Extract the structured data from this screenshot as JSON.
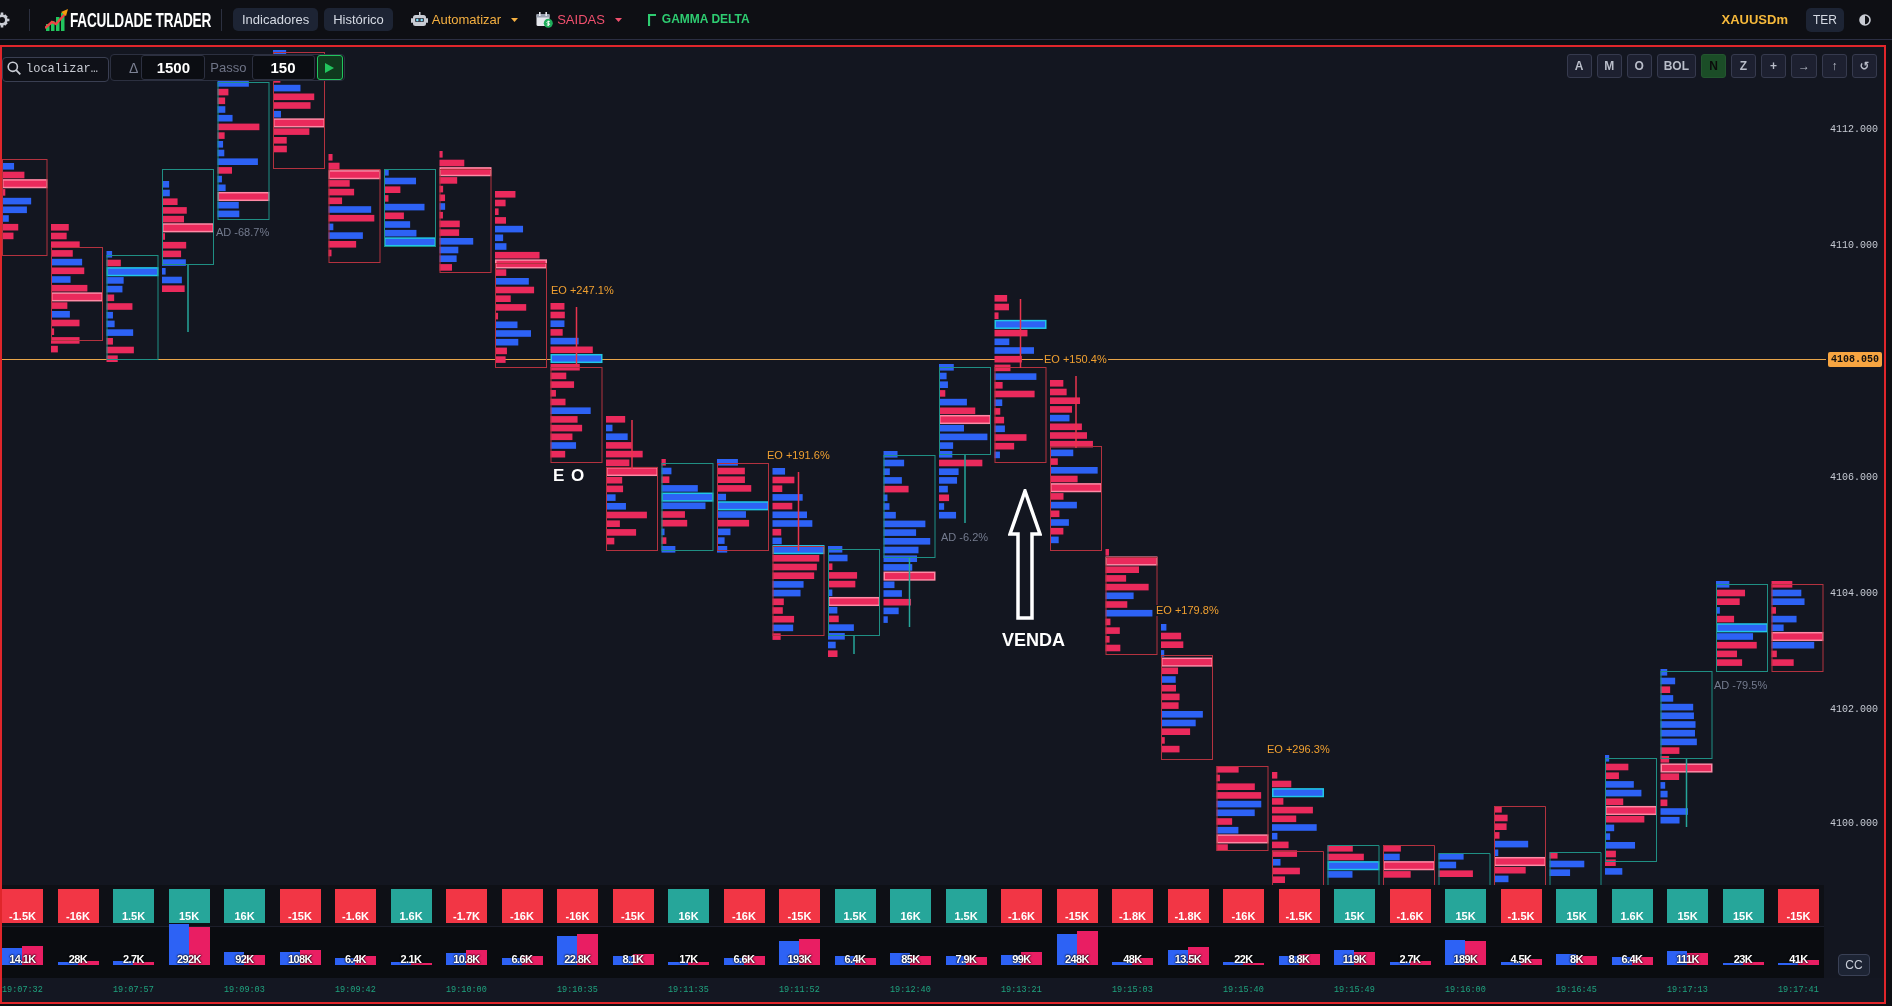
{
  "header": {
    "brand": "FACULDADE TRADER",
    "menu": [
      {
        "label": "Indicadores",
        "kind": "pill"
      },
      {
        "label": "Histórico",
        "kind": "pill"
      },
      {
        "label": "Automatizar",
        "kind": "dropdown",
        "color": "#f5b041"
      },
      {
        "label": "SAIDAS",
        "kind": "dropdown",
        "color": "#f0506e"
      },
      {
        "label": "GAMMA DELTA",
        "kind": "link",
        "color": "#2ecc71"
      }
    ],
    "symbol": "XAUUSDm",
    "timeframe": "TER"
  },
  "toolbar": {
    "search": {
      "placeholder": "localizar…"
    },
    "delta_label": "Δ",
    "size": {
      "value": "1500"
    },
    "step": {
      "label": "Passo",
      "value": "150"
    }
  },
  "chart_buttons": [
    {
      "label": "A",
      "selected": false
    },
    {
      "label": "M",
      "selected": false
    },
    {
      "label": "O",
      "selected": false
    },
    {
      "label": "BOL",
      "selected": false
    },
    {
      "label": "N",
      "selected": true
    },
    {
      "label": "Z",
      "selected": false
    },
    {
      "label": "+",
      "selected": false
    },
    {
      "label": "→",
      "selected": false
    },
    {
      "label": "↑",
      "selected": false
    },
    {
      "label": "↺",
      "selected": false
    }
  ],
  "chart": {
    "price_labels": [
      "4112.000",
      "4110.000",
      "4106.000",
      "4104.000",
      "4102.000",
      "4100.000"
    ],
    "last_price": "4108.050",
    "annotations": [
      {
        "text": "AD -68.7%",
        "kind": "ad"
      },
      {
        "text": "EO +247.1%",
        "kind": "eo"
      },
      {
        "text": "E O",
        "kind": "mark"
      },
      {
        "text": "EO +191.6%",
        "kind": "eo"
      },
      {
        "text": "AD -6.2%",
        "kind": "ad"
      },
      {
        "text": "EO +150.4%",
        "kind": "eo"
      },
      {
        "text": "VENDA",
        "kind": "signal"
      },
      {
        "text": "EO +179.8%",
        "kind": "eo"
      },
      {
        "text": "EO +296.3%",
        "kind": "eo"
      },
      {
        "text": "AD -79.5%",
        "kind": "ad"
      }
    ]
  },
  "delta_row": [
    {
      "value": "-1.5K",
      "color": "#f23645"
    },
    {
      "value": "-16K",
      "color": "#f23645"
    },
    {
      "value": "1.5K",
      "color": "#26a69a"
    },
    {
      "value": "15K",
      "color": "#26a69a"
    },
    {
      "value": "16K",
      "color": "#26a69a"
    },
    {
      "value": "-15K",
      "color": "#f23645"
    },
    {
      "value": "-1.6K",
      "color": "#f23645"
    },
    {
      "value": "1.6K",
      "color": "#26a69a"
    },
    {
      "value": "-1.7K",
      "color": "#f23645"
    },
    {
      "value": "-16K",
      "color": "#f23645"
    },
    {
      "value": "-16K",
      "color": "#f23645"
    },
    {
      "value": "-15K",
      "color": "#f23645"
    },
    {
      "value": "16K",
      "color": "#26a69a"
    },
    {
      "value": "-16K",
      "color": "#f23645"
    },
    {
      "value": "-15K",
      "color": "#f23645"
    },
    {
      "value": "1.5K",
      "color": "#26a69a"
    },
    {
      "value": "16K",
      "color": "#26a69a"
    },
    {
      "value": "1.5K",
      "color": "#26a69a"
    },
    {
      "value": "-1.6K",
      "color": "#f23645"
    },
    {
      "value": "-15K",
      "color": "#f23645"
    },
    {
      "value": "-1.8K",
      "color": "#f23645"
    },
    {
      "value": "-1.8K",
      "color": "#f23645"
    },
    {
      "value": "-16K",
      "color": "#f23645"
    },
    {
      "value": "-1.5K",
      "color": "#f23645"
    },
    {
      "value": "15K",
      "color": "#26a69a"
    },
    {
      "value": "-1.6K",
      "color": "#f23645"
    },
    {
      "value": "15K",
      "color": "#26a69a"
    },
    {
      "value": "-1.5K",
      "color": "#f23645"
    },
    {
      "value": "15K",
      "color": "#26a69a"
    },
    {
      "value": "1.6K",
      "color": "#26a69a"
    },
    {
      "value": "15K",
      "color": "#26a69a"
    },
    {
      "value": "15K",
      "color": "#26a69a"
    },
    {
      "value": "-15K",
      "color": "#f23645"
    }
  ],
  "volume_row": [
    "14.1K",
    "28K",
    "2.7K",
    "292K",
    "92K",
    "108K",
    "6.4K",
    "2.1K",
    "10.8K",
    "6.6K",
    "22.8K",
    "8.1K",
    "17K",
    "6.6K",
    "193K",
    "6.4K",
    "85K",
    "7.9K",
    "99K",
    "248K",
    "48K",
    "13.5K",
    "22K",
    "8.8K",
    "119K",
    "2.7K",
    "189K",
    "4.5K",
    "8K",
    "6.4K",
    "111K",
    "23K",
    "41K"
  ],
  "time_labels": [
    "19:07:32",
    "19:07:57",
    "19:09:03",
    "19:09:42",
    "19:10:00",
    "19:10:35",
    "19:11:35",
    "19:11:52",
    "19:12:40",
    "19:13:21",
    "19:15:03",
    "19:15:40",
    "19:15:49",
    "19:16:00",
    "19:16:45",
    "19:17:13",
    "19:17:41"
  ],
  "cc_button": "CC"
}
